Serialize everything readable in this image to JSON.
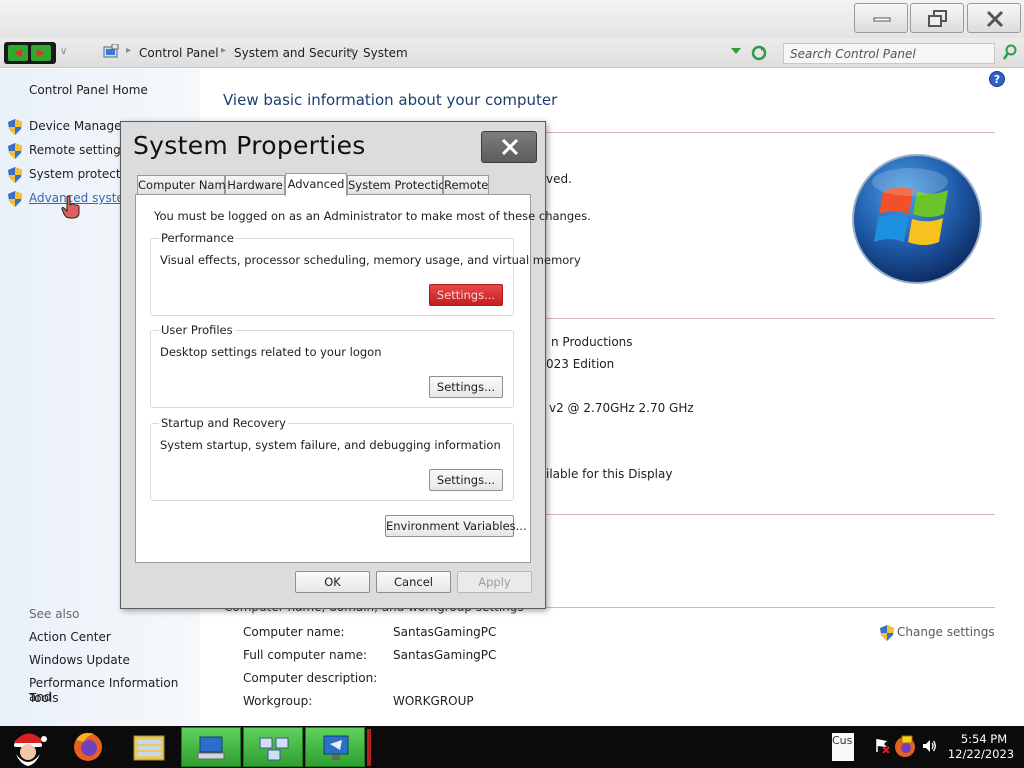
{
  "address_bar": {
    "breadcrumbs": [
      "Control Panel",
      "System and Security",
      "System"
    ],
    "search_placeholder": "Search Control Panel"
  },
  "sidebar": {
    "home": "Control Panel Home",
    "links": [
      "Device Manager",
      "Remote settings",
      "System protection",
      "Advanced system settings"
    ],
    "see_also": "See also",
    "see_also_links": [
      "Action Center",
      "Windows Update",
      "Performance Information and",
      "Tools"
    ]
  },
  "main": {
    "title": "View basic information about your computer",
    "partial_text": {
      "rights": "ved.",
      "manufacturer": "n Productions",
      "edition": "023 Edition",
      "processor": "v2 @ 2.70GHz   2.70 GHz",
      "pen_touch": "ilable for this Display"
    },
    "computer_name_section": "Computer name, domain, and workgroup settings",
    "change_settings": "Change settings",
    "computer_info": [
      {
        "label": "Computer name:",
        "value": "SantasGamingPC"
      },
      {
        "label": "Full computer name:",
        "value": "SantasGamingPC"
      },
      {
        "label": "Computer description:",
        "value": ""
      },
      {
        "label": "Workgroup:",
        "value": "WORKGROUP"
      }
    ]
  },
  "dialog": {
    "title": "System Properties",
    "tabs": [
      "Computer Name",
      "Hardware",
      "Advanced",
      "System Protection",
      "Remote"
    ],
    "active_tab": "Advanced",
    "admin_note": "You must be logged on as an Administrator to make most of these changes.",
    "groups": [
      {
        "title": "Performance",
        "desc": "Visual effects, processor scheduling, memory usage, and virtual memory",
        "button": "Settings..."
      },
      {
        "title": "User Profiles",
        "desc": "Desktop settings related to your logon",
        "button": "Settings..."
      },
      {
        "title": "Startup and Recovery",
        "desc": "System startup, system failure, and debugging information",
        "button": "Settings..."
      }
    ],
    "env_button": "Environment Variables...",
    "ok": "OK",
    "cancel": "Cancel",
    "apply": "Apply"
  },
  "taskbar": {
    "tray_text": "Cus",
    "time": "5:54 PM",
    "date": "12/22/2023"
  },
  "colors": {
    "accent_green": "#2eaa2e",
    "hot_button_red": "#d83030",
    "title_blue": "#1e3d6e"
  }
}
